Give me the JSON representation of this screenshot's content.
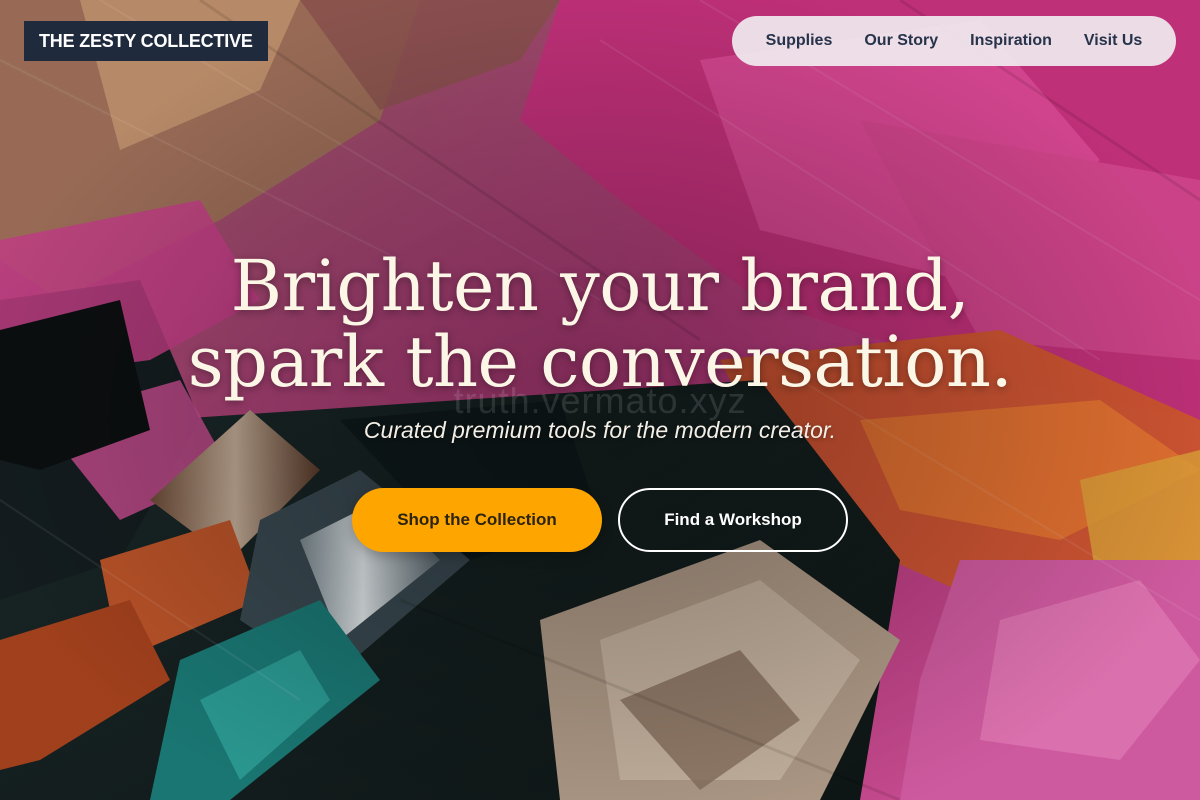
{
  "brand": {
    "logo_text": "THE ZESTY COLLECTIVE"
  },
  "nav": {
    "items": [
      {
        "label": "Supplies"
      },
      {
        "label": "Our Story"
      },
      {
        "label": "Inspiration"
      },
      {
        "label": "Visit Us"
      }
    ]
  },
  "hero": {
    "headline_line1": "Brighten your brand,",
    "headline_line2": "spark the conversation.",
    "watermark": "truth.vermato.xyz",
    "subtitle": "Curated premium tools for the modern creator.",
    "primary_cta": "Shop the Collection",
    "secondary_cta": "Find a Workshop",
    "background_image": "paint-brushes-and-paint-strokes"
  },
  "colors": {
    "accent": "#ffa500",
    "logo_bg": "#1f2a3d",
    "nav_bg": "#f0ecf0",
    "nav_text": "#26334a",
    "headline_text": "#fbf6e6",
    "paint_pink": "#d2408f",
    "paint_orange": "#e8622b"
  }
}
